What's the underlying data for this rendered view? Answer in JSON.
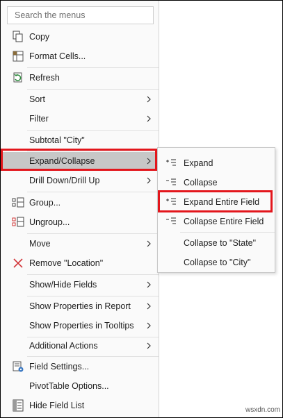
{
  "search": {
    "placeholder": "Search the menus"
  },
  "menu": {
    "copy": "Copy",
    "format_cells": "Format Cells...",
    "refresh": "Refresh",
    "sort": "Sort",
    "filter": "Filter",
    "subtotal": "Subtotal \"City\"",
    "expand_collapse": "Expand/Collapse",
    "drill": "Drill Down/Drill Up",
    "group": "Group...",
    "ungroup": "Ungroup...",
    "move": "Move",
    "remove": "Remove \"Location\"",
    "show_hide_fields": "Show/Hide Fields",
    "show_props_report": "Show Properties in Report",
    "show_props_tooltips": "Show Properties in Tooltips",
    "additional_actions": "Additional Actions",
    "field_settings": "Field Settings...",
    "pivot_options": "PivotTable Options...",
    "hide_field_list": "Hide Field List"
  },
  "submenu": {
    "expand": "Expand",
    "collapse": "Collapse",
    "expand_entire": "Expand Entire Field",
    "collapse_entire": "Collapse Entire Field",
    "collapse_state": "Collapse to \"State\"",
    "collapse_city": "Collapse to \"City\""
  },
  "watermark": "wsxdn.com",
  "colors": {
    "highlight": "#c7c7c7",
    "red_outline": "#e3161c",
    "remove_x": "#d13438"
  }
}
